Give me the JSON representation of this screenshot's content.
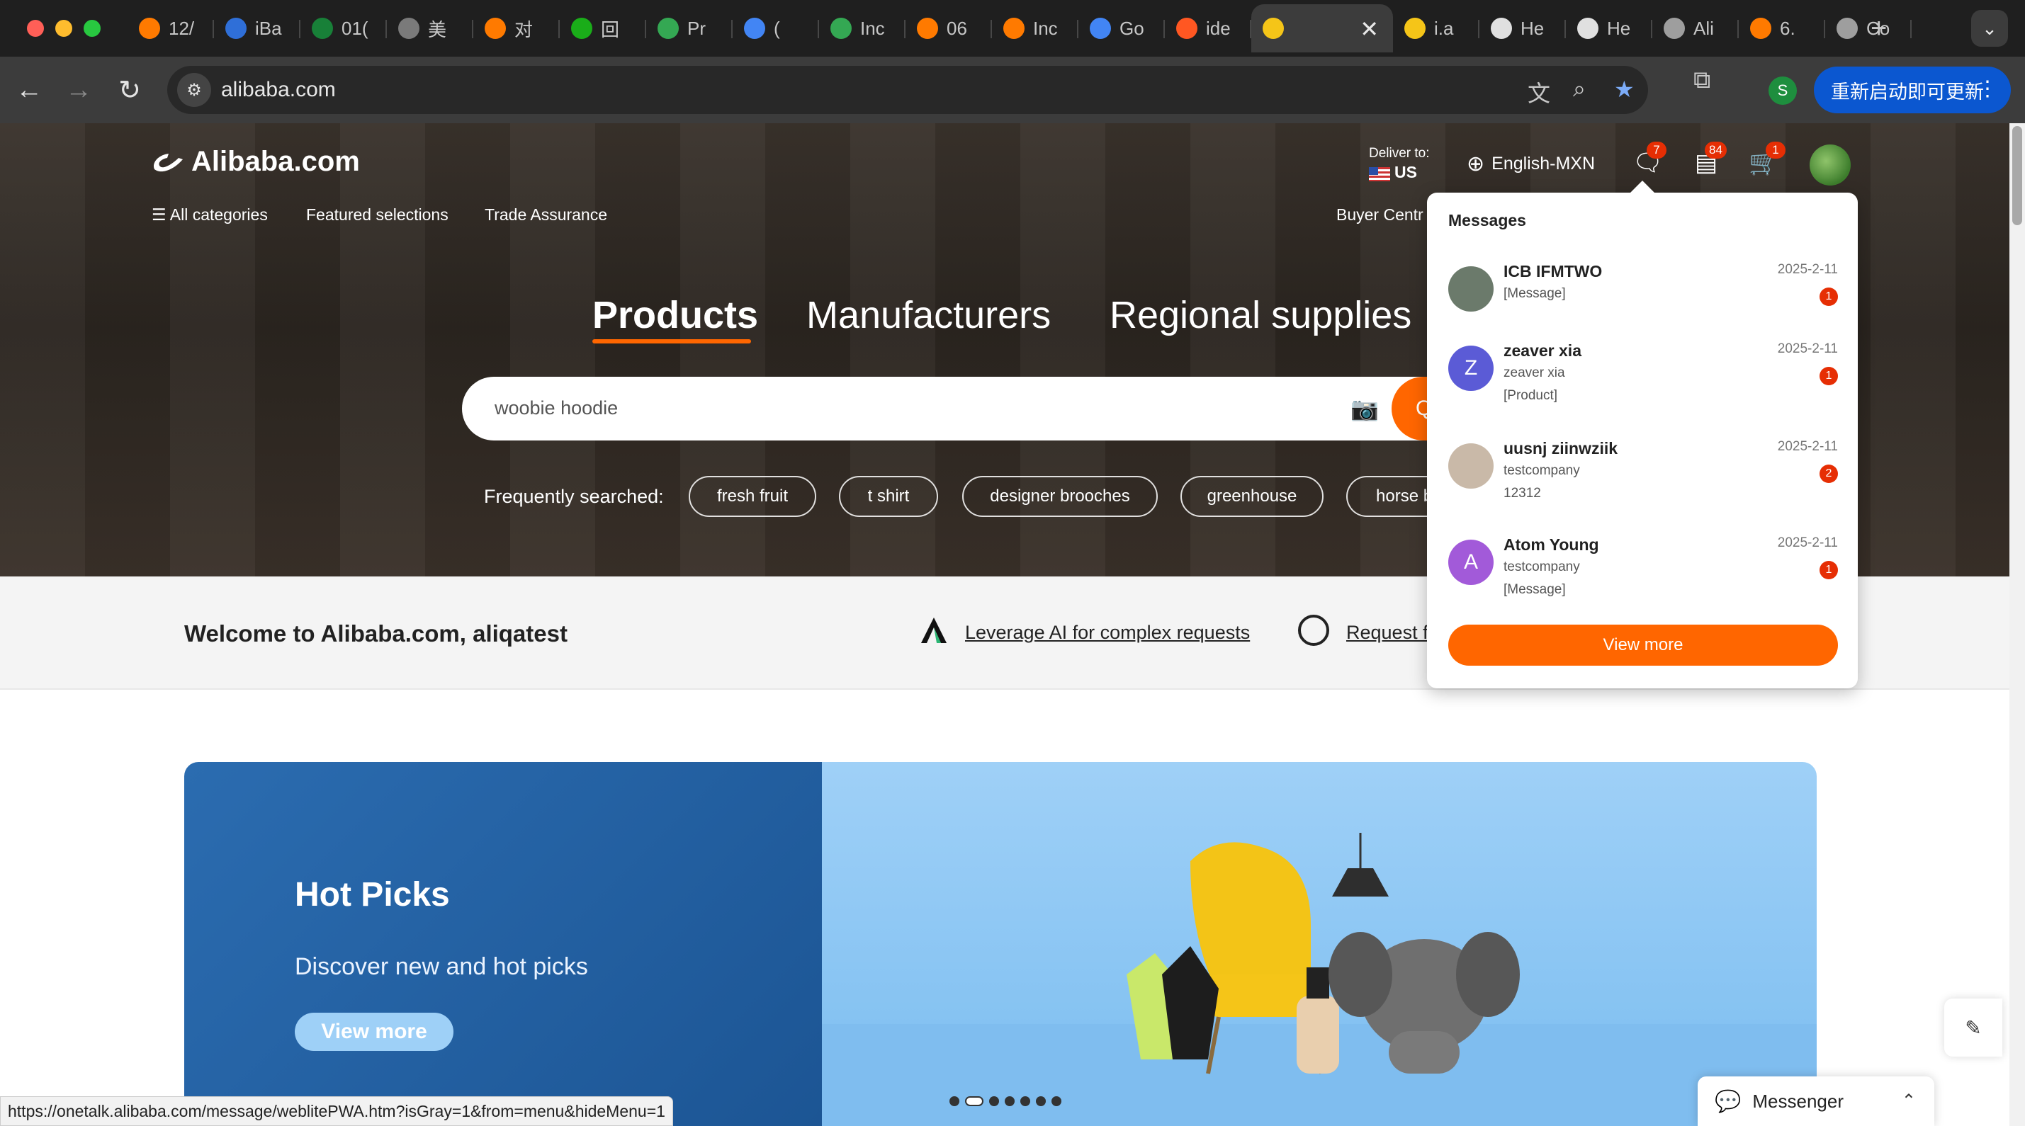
{
  "browser": {
    "tabs": [
      {
        "label": "12/",
        "color": "#ff7a00",
        "icon": "alibaba-icon"
      },
      {
        "label": "iBa",
        "color": "#2f6fd8",
        "icon": "ibank-icon"
      },
      {
        "label": "01(",
        "color": "#188038",
        "icon": "sheets-icon"
      },
      {
        "label": "美",
        "color": "#7a7a7a",
        "icon": "star-burst-icon"
      },
      {
        "label": "对",
        "color": "#ff7a00",
        "icon": "alibaba-icon"
      },
      {
        "label": "回",
        "color": "#1aad19",
        "icon": "lines-icon"
      },
      {
        "label": "Pr",
        "color": "#34a853",
        "icon": "leaf-icon"
      },
      {
        "label": "(",
        "color": "#4285f4",
        "icon": "square-icon"
      },
      {
        "label": "Inc",
        "color": "#34a853",
        "icon": "leaf-icon"
      },
      {
        "label": "06",
        "color": "#ff7a00",
        "icon": "alibaba-icon"
      },
      {
        "label": "Inc",
        "color": "#ff7a00",
        "icon": "alibaba-icon"
      },
      {
        "label": "Go",
        "color": "#4285f4",
        "icon": "translate-icon"
      },
      {
        "label": "ide",
        "color": "#ff5722",
        "icon": "flame-icon"
      }
    ],
    "active_tab": {
      "label": "",
      "color": "#f5c518",
      "icon": "page-icon",
      "close": "✕"
    },
    "tabs_after": [
      {
        "label": "i.a",
        "color": "#f5c518",
        "icon": "page-icon"
      },
      {
        "label": "He",
        "color": "#e0e0e0",
        "icon": "diamond-icon"
      },
      {
        "label": "He",
        "color": "#e0e0e0",
        "icon": "diamond-icon"
      },
      {
        "label": "Ali",
        "color": "#9e9e9e",
        "icon": "globe-icon"
      },
      {
        "label": "6.",
        "color": "#ff7a00",
        "icon": "alibaba-icon"
      },
      {
        "label": "Co",
        "color": "#9e9e9e",
        "icon": "globe-icon"
      }
    ],
    "new_tab": "+",
    "url": "alibaba.com",
    "profile_letter": "S",
    "update_label": "重新启动即可更新",
    "status_url": "https://onetalk.alibaba.com/message/weblitePWA.htm?isGray=1&from=menu&hideMenu=1"
  },
  "header": {
    "logo_text": "Alibaba.com",
    "nav": [
      "All categories",
      "Featured selections",
      "Trade Assurance"
    ],
    "deliver_label": "Deliver to:",
    "deliver_country": "US",
    "language": "English-MXN",
    "message_badge": "7",
    "orders_badge": "84",
    "cart_badge": "1",
    "buyer_central": "Buyer Centr"
  },
  "hero": {
    "tabs": [
      "Products",
      "Manufacturers",
      "Regional supplies"
    ],
    "search_value": "woobie hoodie",
    "search_button": "Q",
    "frequently_label": "Frequently searched:",
    "chips": [
      "fresh fruit",
      "t shirt",
      "designer brooches",
      "greenhouse",
      "horse b"
    ]
  },
  "welcome": {
    "text": "Welcome to Alibaba.com, aliqatest",
    "ai_link": "Leverage AI for complex requests",
    "rfq_link": "Request f"
  },
  "banner": {
    "title": "Hot Picks",
    "subtitle": "Discover new and hot picks",
    "button": "View more"
  },
  "messages": {
    "title": "Messages",
    "items": [
      {
        "name": "ICB IFMTWO",
        "lines": [
          "[Message]"
        ],
        "date": "2025-2-11",
        "count": "1",
        "avatar_letter": "",
        "avatar_color": "#6b7a6b"
      },
      {
        "name": "zeaver xia",
        "lines": [
          "zeaver xia",
          "[Product]"
        ],
        "date": "2025-2-11",
        "count": "1",
        "avatar_letter": "Z",
        "avatar_color": "#5b5bd6"
      },
      {
        "name": "uusnj ziinwziik",
        "lines": [
          "testcompany",
          "12312"
        ],
        "date": "2025-2-11",
        "count": "2",
        "avatar_letter": "",
        "avatar_color": "#c9b9a8"
      },
      {
        "name": "Atom Young",
        "lines": [
          "testcompany",
          "[Message]"
        ],
        "date": "2025-2-11",
        "count": "1",
        "avatar_letter": "A",
        "avatar_color": "#a25ad9"
      }
    ],
    "view_more": "View more"
  },
  "messenger": {
    "label": "Messenger"
  },
  "colors": {
    "accent": "#ff6600",
    "badge": "#e62e04",
    "chrome_blue": "#0b57d0"
  }
}
